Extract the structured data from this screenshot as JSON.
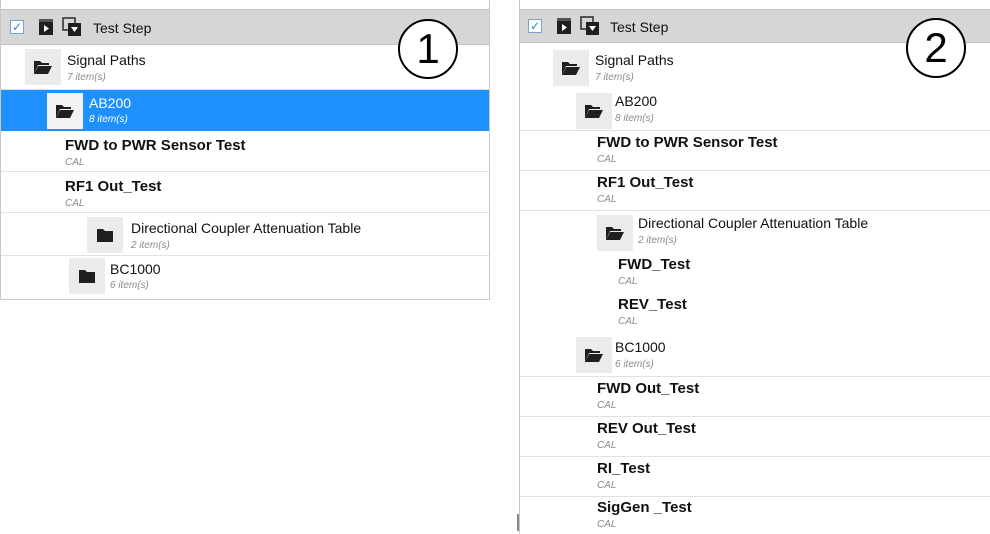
{
  "panel1": {
    "badge": "1",
    "header": {
      "label": "Test Step"
    },
    "rows": [
      {
        "type": "folder",
        "name": "Signal Paths",
        "sub": "7 item(s)",
        "icon": "folder-open-icon"
      },
      {
        "type": "folder",
        "name": "AB200",
        "sub": "8 item(s)",
        "icon": "folder-open-icon",
        "selected": true
      },
      {
        "type": "test",
        "name": "FWD to PWR Sensor Test",
        "sub": "CAL"
      },
      {
        "type": "test",
        "name": "RF1 Out_Test",
        "sub": "CAL"
      },
      {
        "type": "folder",
        "name": "Directional Coupler Attenuation Table",
        "sub": "2 item(s)",
        "icon": "folder-closed-icon"
      },
      {
        "type": "folder",
        "name": "BC1000",
        "sub": "6 item(s)",
        "icon": "folder-closed-icon"
      }
    ]
  },
  "panel2": {
    "badge": "2",
    "header": {
      "label": "Test Step"
    },
    "rows": [
      {
        "type": "folder",
        "name": "Signal Paths",
        "sub": "7 item(s)",
        "icon": "folder-open-icon"
      },
      {
        "type": "folder",
        "name": "AB200",
        "sub": "8 item(s)",
        "icon": "folder-open-icon"
      },
      {
        "type": "test",
        "name": "FWD to PWR Sensor Test",
        "sub": "CAL"
      },
      {
        "type": "test",
        "name": "RF1 Out_Test",
        "sub": "CAL"
      },
      {
        "type": "folder",
        "name": "Directional Coupler Attenuation Table",
        "sub": "2 item(s)",
        "icon": "folder-open-icon"
      },
      {
        "type": "test",
        "name": "FWD_Test",
        "sub": "CAL"
      },
      {
        "type": "test",
        "name": "REV_Test",
        "sub": "CAL"
      },
      {
        "type": "folder",
        "name": "BC1000",
        "sub": "6 item(s)",
        "icon": "folder-open-icon"
      },
      {
        "type": "test",
        "name": "FWD Out_Test",
        "sub": "CAL"
      },
      {
        "type": "test",
        "name": "REV Out_Test",
        "sub": "CAL"
      },
      {
        "type": "test",
        "name": "RI_Test",
        "sub": "CAL"
      },
      {
        "type": "test",
        "name": "SigGen _Test",
        "sub": "CAL"
      }
    ]
  }
}
